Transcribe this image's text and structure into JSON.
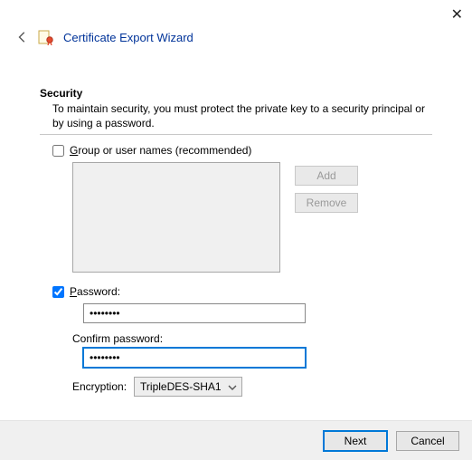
{
  "header": {
    "title": "Certificate Export Wizard"
  },
  "section": {
    "heading": "Security",
    "description": "To maintain security, you must protect the private key to a security principal or by using a password."
  },
  "options": {
    "group": {
      "label": "Group or user names (recommended)",
      "checked": false,
      "add": "Add",
      "remove": "Remove"
    },
    "password": {
      "label": "Password:",
      "checked": true,
      "value": "••••••••",
      "confirm_label": "Confirm password:",
      "confirm_value": "••••••••"
    },
    "encryption": {
      "label": "Encryption:",
      "value": "TripleDES-SHA1"
    }
  },
  "footer": {
    "next": "Next",
    "cancel": "Cancel"
  }
}
